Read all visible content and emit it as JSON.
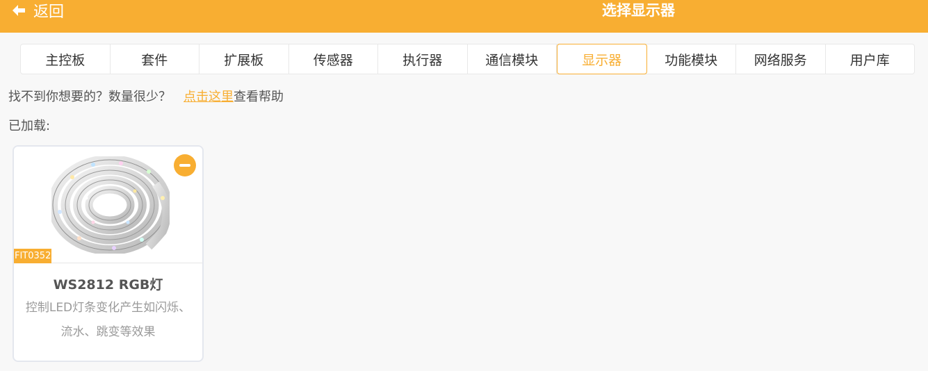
{
  "header": {
    "back_label": "返回",
    "title": "选择显示器",
    "bar_color": "#f8ae32"
  },
  "tabs": [
    {
      "label": "主控板",
      "active": false
    },
    {
      "label": "套件",
      "active": false
    },
    {
      "label": "扩展板",
      "active": false
    },
    {
      "label": "传感器",
      "active": false
    },
    {
      "label": "执行器",
      "active": false
    },
    {
      "label": "通信模块",
      "active": false
    },
    {
      "label": "显示器",
      "active": true
    },
    {
      "label": "功能模块",
      "active": false
    },
    {
      "label": "网络服务",
      "active": false
    },
    {
      "label": "用户库",
      "active": false
    }
  ],
  "help": {
    "prompt": "找不到你想要的？数量很少？",
    "link": "点击这里",
    "suffix": "查看帮助"
  },
  "loaded_label": "已加载:",
  "cards": [
    {
      "sku": "FIT0352",
      "name": "WS2812 RGB灯",
      "description": "控制LED灯条变化产生如闪烁、流水、跳变等效果",
      "image_icon": "led-strip-reel",
      "remove_icon": "minus-circle-icon"
    }
  ],
  "accent_color": "#f8ae32"
}
